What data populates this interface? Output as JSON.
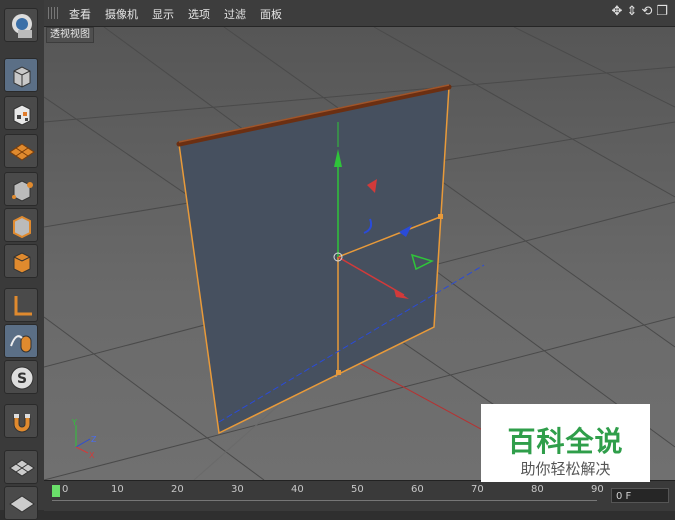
{
  "menu": {
    "items": [
      "查看",
      "摄像机",
      "显示",
      "选项",
      "过滤",
      "面板"
    ]
  },
  "viewport": {
    "label": "透视视图",
    "axis_labels": {
      "y": "Y",
      "z": "Z",
      "x": "X"
    }
  },
  "timeline": {
    "ticks": [
      "0",
      "10",
      "20",
      "30",
      "40",
      "50",
      "60",
      "70",
      "80",
      "90"
    ],
    "frame_value": "0 F"
  },
  "toolbar": {
    "icons": [
      "view-cube-icon",
      "checker-cube-icon",
      "texture-icon",
      "points-mode-icon",
      "edges-mode-icon",
      "polygon-mode-icon",
      "axis-icon",
      "mouse-tweak-icon",
      "snap-icon",
      "magnet-icon",
      "workplane-icon",
      "workplane-lock-icon"
    ]
  },
  "watermark": {
    "title": "百科全说",
    "subtitle": "助你轻松解决"
  },
  "colors": {
    "accent_orange": "#e89a3a",
    "axis_x": "#d23a3a",
    "axis_y": "#2fc43a",
    "axis_z": "#2a4bd8",
    "brand_green": "#2f9e4a"
  }
}
